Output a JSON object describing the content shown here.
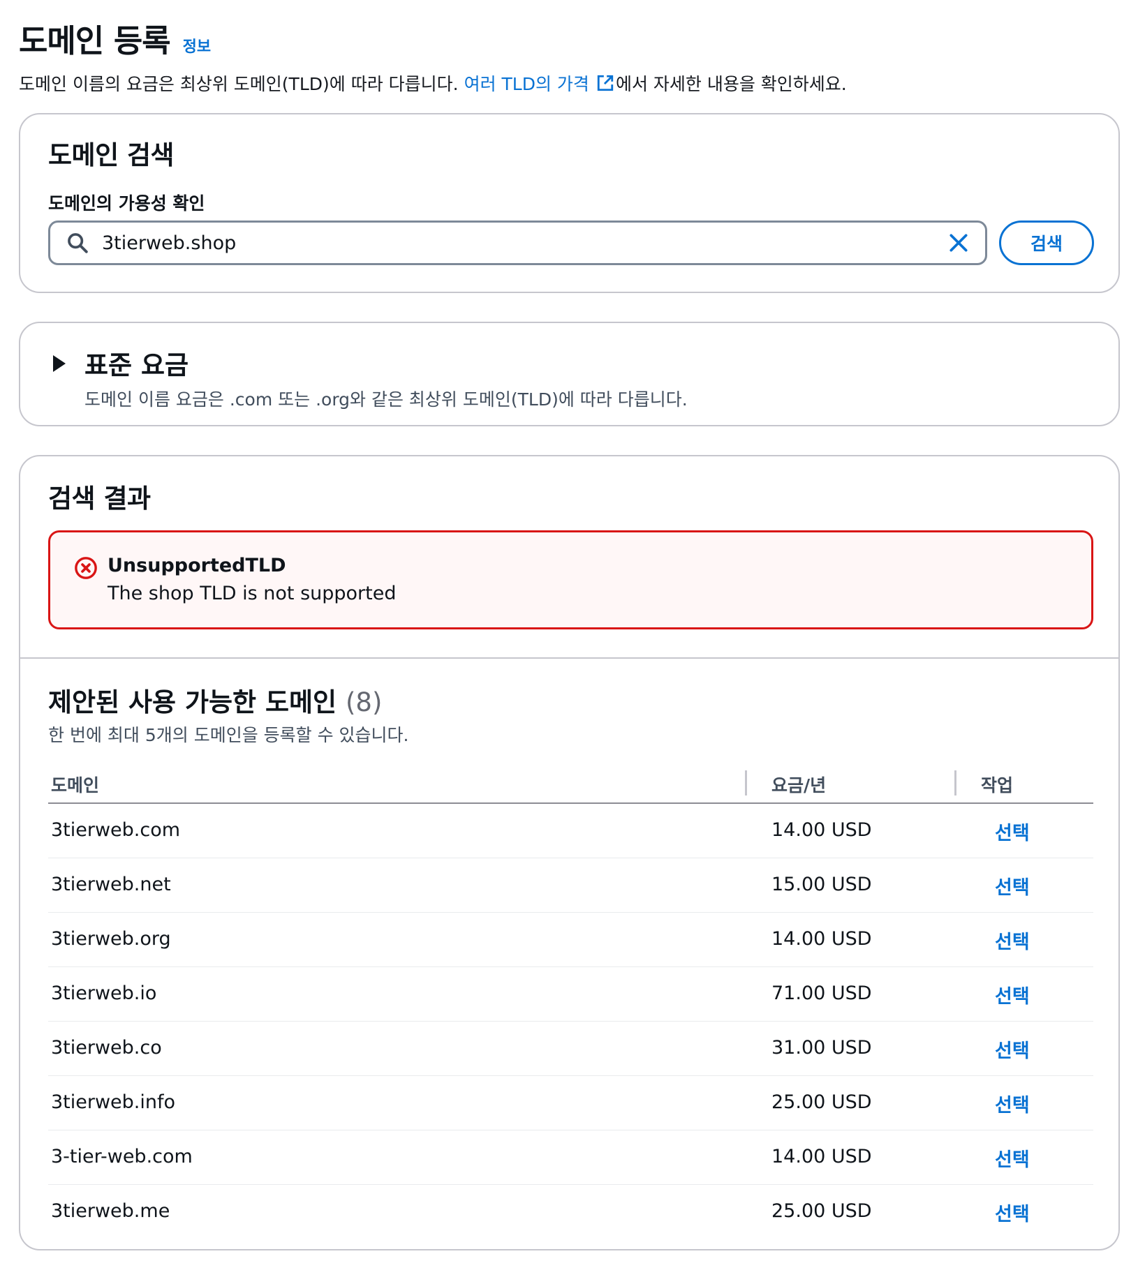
{
  "header": {
    "title": "도메인 등록",
    "info_link": "정보",
    "description_prefix": "도메인 이름의 요금은 최상위 도메인(TLD)에 따라 다릅니다.",
    "pricing_link": "여러 TLD의 가격",
    "description_suffix": "에서 자세한 내용을 확인하세요."
  },
  "search": {
    "title": "도메인 검색",
    "label": "도메인의 가용성 확인",
    "value": "3tierweb.shop",
    "button": "검색"
  },
  "pricing": {
    "title": "표준 요금",
    "description": "도메인 이름 요금은 .com 또는 .org와 같은 최상위 도메인(TLD)에 따라 다릅니다."
  },
  "results": {
    "title": "검색 결과",
    "error": {
      "title": "UnsupportedTLD",
      "message": "The shop TLD is not supported"
    },
    "suggested_title": "제안된 사용 가능한 도메인",
    "suggested_count": "(8)",
    "suggested_desc": "한 번에 최대 5개의 도메인을 등록할 수 있습니다.",
    "columns": {
      "domain": "도메인",
      "price": "요금/년",
      "action": "작업"
    },
    "rows": [
      {
        "domain": "3tierweb.com",
        "price": "14.00 USD",
        "action": "선택"
      },
      {
        "domain": "3tierweb.net",
        "price": "15.00 USD",
        "action": "선택"
      },
      {
        "domain": "3tierweb.org",
        "price": "14.00 USD",
        "action": "선택"
      },
      {
        "domain": "3tierweb.io",
        "price": "71.00 USD",
        "action": "선택"
      },
      {
        "domain": "3tierweb.co",
        "price": "31.00 USD",
        "action": "선택"
      },
      {
        "domain": "3tierweb.info",
        "price": "25.00 USD",
        "action": "선택"
      },
      {
        "domain": "3-tier-web.com",
        "price": "14.00 USD",
        "action": "선택"
      },
      {
        "domain": "3tierweb.me",
        "price": "25.00 USD",
        "action": "선택"
      }
    ]
  },
  "colors": {
    "link": "#0972d3",
    "error": "#d91515",
    "border": "#c6c6cd"
  }
}
